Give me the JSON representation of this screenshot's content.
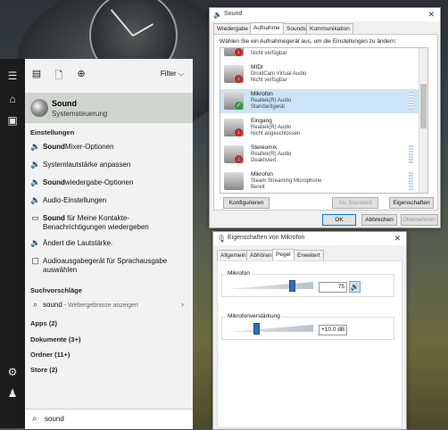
{
  "colors": {
    "taskbar": "#1c1c1c",
    "selected_best": "#cfd5ce",
    "selected_device": "#cde4f7",
    "slider": "#2f6fb5"
  },
  "start": {
    "top_icons": [
      "document-grid-icon",
      "page-icon",
      "globe-icon"
    ],
    "filter_label": "Filter",
    "best_match": {
      "title": "Sound",
      "subtitle": "Systemsteuerung"
    },
    "settings_header": "Einstellungen",
    "settings": [
      {
        "bold": "Sound",
        "rest": "Mixer-Optionen",
        "icon": "speaker-icon"
      },
      {
        "bold": "",
        "rest": "Systemlautstärke anpassen",
        "icon": "volume-icon"
      },
      {
        "bold": "Sound",
        "rest": "wiedergabe-Optionen",
        "icon": "speaker-icon"
      },
      {
        "bold": "",
        "rest": "Audio-Einstellungen",
        "icon": "speaker-icon"
      },
      {
        "bold": "Sound",
        "rest": " für Meine Kontakte-",
        "line2": "Benachrichtigungen wiedergeben",
        "icon": "laptop-icon"
      },
      {
        "bold": "",
        "rest": "Ändert die Lautstärke.",
        "icon": "volume-icon"
      },
      {
        "bold": "",
        "rest": "Audioausgabegerät für Sprachausgabe",
        "line2": "auswählen",
        "icon": "speech-icon"
      }
    ],
    "suggestions_header": "Suchvorschläge",
    "suggestion": {
      "term": "sound",
      "hint": " - Webergebnisse anzeigen"
    },
    "categories": [
      "Apps (2)",
      "Dokumente (3+)",
      "Ordner (11+)",
      "Store (2)"
    ],
    "search_value": "sound"
  },
  "sound_dialog": {
    "title": "Sound",
    "tabs": [
      "Wiedergabe",
      "Aufnahme",
      "Sounds",
      "Kommunikation"
    ],
    "active_tab": 1,
    "hint": "Wählen Sie ein Aufnahmegerät aus, um die Einstellungen zu ändern:",
    "devices": [
      {
        "name": "",
        "driver": "",
        "status": "Nicht verfügbar",
        "badge": "down"
      },
      {
        "name": "MIDI",
        "driver": "DroidCam Virtual Audio",
        "status": "Nicht verfügbar",
        "badge": "down"
      },
      {
        "name": "Mikrofon",
        "driver": "Realtek(R) Audio",
        "status": "Standardgerät",
        "badge": "check"
      },
      {
        "name": "Eingang",
        "driver": "Realtek(R) Audio",
        "status": "Nicht angeschlossen",
        "badge": "down"
      },
      {
        "name": "Stereomix",
        "driver": "Realtek(R) Audio",
        "status": "Deaktiviert",
        "badge": "down"
      },
      {
        "name": "Mikrofon",
        "driver": "Steam Streaming Microphone",
        "status": "Bereit",
        "badge": ""
      }
    ],
    "configure": "Konfigurieren",
    "set_default": "Als Standard",
    "properties": "Eigenschaften",
    "ok": "OK",
    "cancel": "Abbrechen",
    "apply": "Übernehmen"
  },
  "mic_dialog": {
    "title": "Eigenschaften von Mikrofon",
    "tabs": [
      "Allgemein",
      "Abhören",
      "Pegel",
      "Erweitert"
    ],
    "active_tab": 2,
    "mic_label": "Mikrofon",
    "mic_value": "75",
    "mic_level": 0.75,
    "boost_label": "Mikrofonverstärkung",
    "boost_value": "+10.0 dB",
    "boost_level": 0.33
  }
}
